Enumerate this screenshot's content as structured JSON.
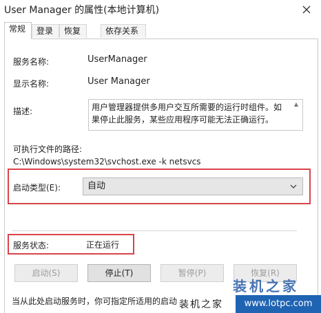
{
  "window": {
    "title": "User Manager 的属性(本地计算机)",
    "close_icon": "close-icon"
  },
  "tabs": [
    {
      "label": "常规",
      "active": true
    },
    {
      "label": "登录",
      "active": false
    },
    {
      "label": "恢复",
      "active": false
    },
    {
      "label": "依存关系",
      "active": false
    }
  ],
  "general": {
    "service_name_label": "服务名称:",
    "service_name_value": "UserManager",
    "display_name_label": "显示名称:",
    "display_name_value": "User Manager",
    "description_label": "描述:",
    "description_value": "用户管理器提供多用户交互所需要的运行时组件。如果停止此服务，某些应用程序可能无法正确运行。",
    "exe_path_label": "可执行文件的路径:",
    "exe_path_value": "C:\\Windows\\system32\\svchost.exe -k netsvcs",
    "startup_type_label": "启动类型(E):",
    "startup_type_value": "自动",
    "service_status_label": "服务状态:",
    "service_status_value": "正在运行"
  },
  "buttons": {
    "start": "启动(S)",
    "stop": "停止(T)",
    "pause": "暂停(P)",
    "resume": "恢复(R)"
  },
  "footnote": "当从此处启动服务时，你可指定所适用的启动",
  "watermark": {
    "big": "装机之家",
    "text": "装机之家",
    "url": "www.lotpc.com"
  },
  "colors": {
    "highlight_box": "#d9434a",
    "watermark_blue": "#1f64b3"
  }
}
